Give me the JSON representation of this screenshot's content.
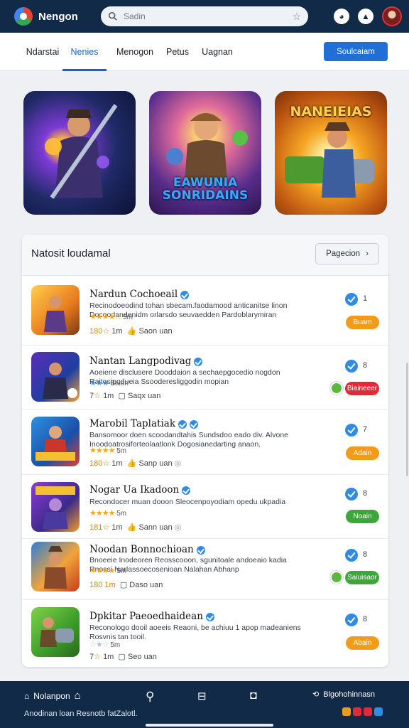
{
  "app": {
    "title": "Nengon",
    "search_placeholder": "Sadin"
  },
  "tabs": [
    {
      "label": "Ndarstai"
    },
    {
      "label": "Nenies"
    },
    {
      "label": "Menogon"
    },
    {
      "label": "Petus"
    },
    {
      "label": "Uagnan"
    }
  ],
  "tabs_button": "Soulcaiam",
  "featured": [
    {
      "title": ""
    },
    {
      "title": "EAWUNIA SONRIDAINS"
    },
    {
      "title": "NANEIEIAS"
    }
  ],
  "panel": {
    "title": "Natosit loudamal",
    "button": "Pagecion"
  },
  "apps": [
    {
      "name": "Nardun Cochoeail",
      "desc": "Recinodoeodind tohan sbecam.faodamood anticanitse linon Docoodandenidm orlarsdo seuvaedden Pardoblarymiran",
      "rating_text": "5m",
      "meta_value": "180",
      "meta_suffix": "1m",
      "meta_link": "Saon uan",
      "count": "1",
      "action": "Buam",
      "action_color": "#f39a18"
    },
    {
      "name": "Nantan Langpodivag",
      "desc": "Aoeiene disclusere Dooddaion a sechaepgocedio nogdon Raitosipodueia Ssooderesliggodin mopian",
      "rating_text": "Baion",
      "meta_value": "7",
      "meta_suffix": "1m",
      "meta_link": "Saqx uan",
      "count": "8",
      "action": "Biaineeer",
      "action_color": "#e4283a"
    },
    {
      "name": "Marobil Taplatiak",
      "desc": "Bansomoor doen scoodandtahis Sundsdoo eado div. Alvone Inoodoatrosiforteolaatlonk Dogosianedarting anaon.",
      "rating_text": "5m",
      "meta_value": "180",
      "meta_suffix": "1m",
      "meta_link": "Sanp uan",
      "count": "7",
      "action": "Adain",
      "action_color": "#f39a18"
    },
    {
      "name": "Nogar Ua Ikadoon",
      "desc": "Recondocer muan dooon Sleocenpoyodiam opedu ukpadia",
      "rating_text": "5m",
      "meta_value": "181",
      "meta_suffix": "1m",
      "meta_link": "Sann uan",
      "count": "8",
      "action": "Noain",
      "action_color": "#3da63b"
    },
    {
      "name": "Noodan Bonnochioan",
      "desc": "Bnoeeie Inodeoren Reosscooon, sgunitoale andoeaio kadia Rnossi Narlassoecosenioan Nalahan Abhanp",
      "rating_text": "5m",
      "meta_value": "180",
      "meta_suffix": "1m",
      "meta_link": "Daso uan",
      "count": "8",
      "action": "Saiuisaor",
      "action_color": "#3da63b"
    },
    {
      "name": "Dpkitar Paeoedhaidean",
      "desc": "Reconologo dooil aoeeis Reaoni, be achiuu 1 apop madeaniens Rosvnis tan tooil.",
      "rating_text": "5m",
      "meta_value": "7",
      "meta_suffix": "1m",
      "meta_link": "Seo uan",
      "count": "8",
      "action": "Abain",
      "action_color": "#f39a18"
    }
  ],
  "bottom_nav": {
    "home": "Nolanpon",
    "right": "Blgohohinnasn",
    "caption": "Anodinan loan Resnotb fatZalotl."
  }
}
